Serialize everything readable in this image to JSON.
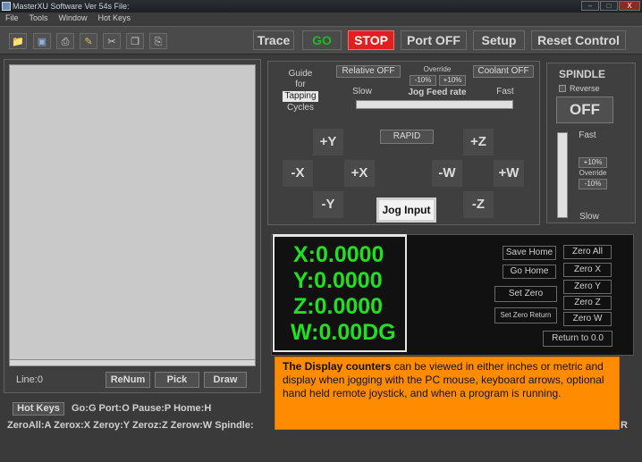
{
  "window": {
    "title": "MasterXU Software Ver 54s File:",
    "min": "–",
    "max": "□",
    "close": "X"
  },
  "menu": [
    "File",
    "Tools",
    "Window",
    "Hot Keys"
  ],
  "toolbar": {
    "trace": "Trace",
    "go": "GO",
    "stop": "STOP",
    "port": "Port OFF",
    "setup": "Setup",
    "reset": "Reset Control"
  },
  "program": {
    "line": "Line:0",
    "renum": "ReNum",
    "pick": "Pick",
    "draw": "Draw"
  },
  "hotkeys": {
    "button": "Hot Keys",
    "line1": "Go:G  Port:O  Pause:P  Home:H",
    "line2": "ZeroAll:A  Zerox:X  Zeroy:Y  Zeroz:Z  Zerow:W  Spindle:",
    "trail": "R"
  },
  "jog": {
    "guide": [
      "Guide",
      "for",
      "Tapping",
      "Cycles"
    ],
    "relative": "Relative OFF",
    "override_label": "Override",
    "minus10": "-10%",
    "plus10": "+10%",
    "slow": "Slow",
    "feed": "Jog Feed rate",
    "fast": "Fast",
    "coolant": "Coolant OFF",
    "rapid": "RAPID",
    "plus_y": "+Y",
    "minus_x": "-X",
    "plus_x": "+X",
    "minus_y": "-Y",
    "plus_z": "+Z",
    "minus_w": "-W",
    "plus_w": "+W",
    "minus_z": "-Z",
    "input": "Jog Input"
  },
  "spindle": {
    "title": "SPINDLE",
    "reverse": "Reverse",
    "state": "OFF",
    "fast": "Fast",
    "plus10": "+10%",
    "override": "Override",
    "minus10": "-10%",
    "slow": "Slow"
  },
  "display": {
    "x": "X:0.0000",
    "y": "Y:0.0000",
    "z": "Z:0.0000",
    "w": "W:0.00DG",
    "save_home": "Save Home",
    "go_home": "Go Home",
    "set_zero": "Set Zero",
    "set_zero_return": "Set Zero Return",
    "zero_all": "Zero All",
    "zero_x": "Zero X",
    "zero_y": "Zero Y",
    "zero_z": "Zero Z",
    "zero_w": "Zero W",
    "return": "Return to 0.0"
  },
  "callout": {
    "bold": "The Display counters",
    "text": " can be viewed in either inches or metric and display when jogging with the PC mouse, keyboard arrows, optional hand held remote joystick, and when a program is running."
  },
  "colors": {
    "counter": "#21e021",
    "stop": "#e02020",
    "go": "#22b822",
    "callout": "#ff8c00"
  }
}
